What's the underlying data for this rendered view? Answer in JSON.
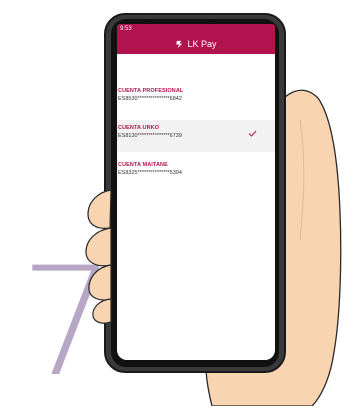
{
  "step_number": "7",
  "status_bar": {
    "time": "9:53"
  },
  "app": {
    "title": "LK Pay",
    "accent_color": "#b2124e",
    "logo_icon": "lk-logo-icon"
  },
  "accounts": [
    {
      "name": "CUENTA PROFESIONAL",
      "iban": "ES8530***************6842",
      "selected": false
    },
    {
      "name": "CUENTA URKO",
      "iban": "ES8130***************6739",
      "selected": true
    },
    {
      "name": "CUENTA MAITANE",
      "iban": "ES8325***************5394",
      "selected": false
    }
  ],
  "selection_icon": "check-icon"
}
